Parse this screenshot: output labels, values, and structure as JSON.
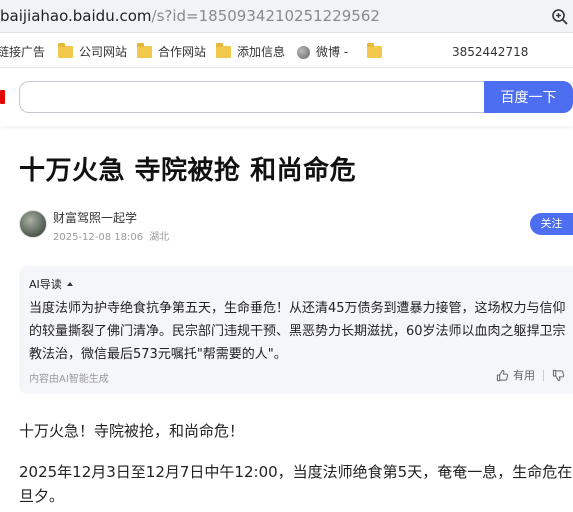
{
  "browser": {
    "url_host": "baijiahao.baidu.com",
    "url_rest": "/s?id=1850934210251229562",
    "zoom_icon": "zoom-icon"
  },
  "bookmarks": {
    "items": [
      {
        "label": "链接广告",
        "icon": "folder-icon"
      },
      {
        "label": "公司网站",
        "icon": "folder-icon"
      },
      {
        "label": "合作网站",
        "icon": "folder-icon"
      },
      {
        "label": "添加信息",
        "icon": "folder-icon"
      },
      {
        "label": "微博 -",
        "icon": "globe-icon"
      },
      {
        "label": "",
        "icon": "folder-icon"
      }
    ],
    "counter": "3852442718"
  },
  "search": {
    "value": "",
    "button_label": "百度一下",
    "accent_color": "#4e6ef2"
  },
  "article": {
    "title": "十万火急 寺院被抢 和尚命危",
    "author": "财富驾照一起学",
    "date": "2025-12-08 18:06",
    "location": "湖北",
    "follow_label": "关注",
    "ai": {
      "heading": "AI导读",
      "summary": "当度法师为护寺绝食抗争第五天，生命垂危！从还清45万债务到遭暴力接管，这场权力与信仰的较量撕裂了佛门清净。民宗部门违规干预、黑恶势力长期滋扰，60岁法师以血肉之躯捍卫宗教法治，微信最后573元嘱托\"帮需要的人\"。",
      "footer": "内容由AI智能生成",
      "useful_label": "有用"
    },
    "paragraphs": [
      "十万火急！寺院被抢，和尚命危！",
      "2025年12月3日至12月7日中午12:00，当度法师绝食第5天，奄奄一息，生命危在旦夕。"
    ]
  }
}
